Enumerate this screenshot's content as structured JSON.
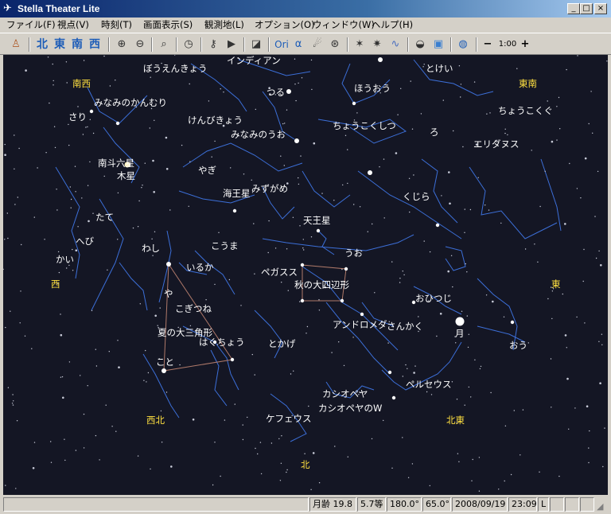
{
  "window": {
    "title": "Stella Theater Lite",
    "controls": [
      "_",
      "□",
      "×"
    ]
  },
  "menu": [
    "ファイル(F)",
    "視点(V)",
    "時刻(T)",
    "画面表示(S)",
    "観測地(L)",
    "オプション(O)",
    "ウィンドウ(W)",
    "ヘルプ(H)"
  ],
  "toolbar": {
    "directions": [
      "北",
      "東",
      "南",
      "西"
    ],
    "ori_label": "Ori",
    "alpha_label": "α",
    "zoom_label": "1:00",
    "zoom_out": "−",
    "zoom_in": "+"
  },
  "sky": {
    "background": "#141624",
    "line_color": "#3c6fd8",
    "label_color": "#ffffff",
    "direction_color": "#ffe040",
    "directions": [
      {
        "text": "南西"
      },
      {
        "text": "東南"
      },
      {
        "text": "西"
      },
      {
        "text": "東"
      },
      {
        "text": "西北"
      },
      {
        "text": "北東"
      },
      {
        "text": "北"
      }
    ],
    "labels": [
      {
        "text": "ぼうえんきょう"
      },
      {
        "text": "インディアン"
      },
      {
        "text": "とけい"
      },
      {
        "text": "つる"
      },
      {
        "text": "ほうおう"
      },
      {
        "text": "みなみのかんむり"
      },
      {
        "text": "ちょうこくぐ"
      },
      {
        "text": "さり"
      },
      {
        "text": "けんびきょう"
      },
      {
        "text": "ちょうこくしつ"
      },
      {
        "text": "みなみのうお"
      },
      {
        "text": "ろ"
      },
      {
        "text": "エリダヌス"
      },
      {
        "text": "南斗六星"
      },
      {
        "text": "木星"
      },
      {
        "text": "やぎ"
      },
      {
        "text": "海王星"
      },
      {
        "text": "みずがめ"
      },
      {
        "text": "くじら"
      },
      {
        "text": "たて"
      },
      {
        "text": "天王星"
      },
      {
        "text": "へび"
      },
      {
        "text": "わし"
      },
      {
        "text": "こうま"
      },
      {
        "text": "うお"
      },
      {
        "text": "かい"
      },
      {
        "text": "いるか"
      },
      {
        "text": "ペガスス"
      },
      {
        "text": "秋の大四辺形"
      },
      {
        "text": "や"
      },
      {
        "text": "おひつじ"
      },
      {
        "text": "こぎつね"
      },
      {
        "text": "アンドロメダ"
      },
      {
        "text": "さんかく"
      },
      {
        "text": "月"
      },
      {
        "text": "夏の大三角形"
      },
      {
        "text": "はくちょう"
      },
      {
        "text": "とかげ"
      },
      {
        "text": "おう"
      },
      {
        "text": "こと"
      },
      {
        "text": "ペルセウス"
      },
      {
        "text": "カシオペヤ"
      },
      {
        "text": "カシオペヤのW"
      },
      {
        "text": "ケフェウス"
      }
    ]
  },
  "status": {
    "moon_age": "月齢 19.8",
    "magnitude": "5.7等",
    "azimuth": "180.0°",
    "altitude": "65.0°",
    "date": "2008/09/19",
    "time": "23:09",
    "flag": "L"
  }
}
